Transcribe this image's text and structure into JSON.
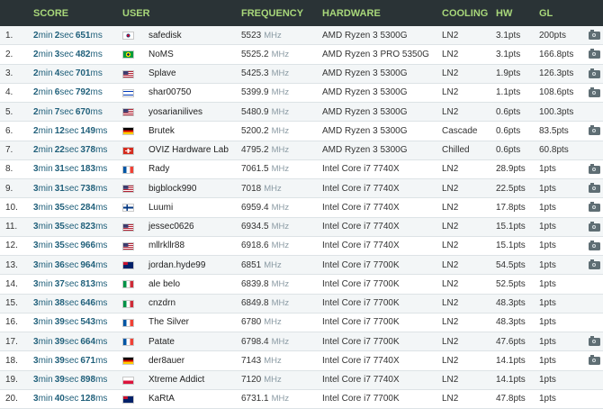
{
  "header": {
    "score": "SCORE",
    "user": "USER",
    "frequency": "FREQUENCY",
    "hardware": "HARDWARE",
    "cooling": "COOLING",
    "hw": "HW",
    "gl": "GL"
  },
  "rows": [
    {
      "rank": "1.",
      "m": "2",
      "s": "2",
      "ms": "651",
      "flag": "kr",
      "user": "safedisk",
      "freq": "5523",
      "hw": "AMD Ryzen 3 5300G",
      "cooling": "LN2",
      "pts": "3.1pts",
      "gl": "200pts",
      "cam": true
    },
    {
      "rank": "2.",
      "m": "2",
      "s": "3",
      "ms": "482",
      "flag": "br",
      "user": "NoMS",
      "freq": "5525.2",
      "hw": "AMD Ryzen 3 PRO 5350G",
      "cooling": "LN2",
      "pts": "3.1pts",
      "gl": "166.8pts",
      "cam": true
    },
    {
      "rank": "3.",
      "m": "2",
      "s": "4",
      "ms": "701",
      "flag": "us",
      "user": "Splave",
      "freq": "5425.3",
      "hw": "AMD Ryzen 3 5300G",
      "cooling": "LN2",
      "pts": "1.9pts",
      "gl": "126.3pts",
      "cam": true
    },
    {
      "rank": "4.",
      "m": "2",
      "s": "6",
      "ms": "792",
      "flag": "il",
      "user": "shar00750",
      "freq": "5399.9",
      "hw": "AMD Ryzen 3 5300G",
      "cooling": "LN2",
      "pts": "1.1pts",
      "gl": "108.6pts",
      "cam": true
    },
    {
      "rank": "5.",
      "m": "2",
      "s": "7",
      "ms": "670",
      "flag": "us",
      "user": "yosarianilives",
      "freq": "5480.9",
      "hw": "AMD Ryzen 3 5300G",
      "cooling": "LN2",
      "pts": "0.6pts",
      "gl": "100.3pts",
      "cam": false
    },
    {
      "rank": "6.",
      "m": "2",
      "s": "12",
      "ms": "149",
      "flag": "de",
      "user": "Brutek",
      "freq": "5200.2",
      "hw": "AMD Ryzen 3 5300G",
      "cooling": "Cascade",
      "pts": "0.6pts",
      "gl": "83.5pts",
      "cam": true
    },
    {
      "rank": "7.",
      "m": "2",
      "s": "22",
      "ms": "378",
      "flag": "ch",
      "user": "OVIZ Hardware Lab",
      "freq": "4795.2",
      "hw": "AMD Ryzen 3 5300G",
      "cooling": "Chilled",
      "pts": "0.6pts",
      "gl": "60.8pts",
      "cam": false
    },
    {
      "rank": "8.",
      "m": "3",
      "s": "31",
      "ms": "183",
      "flag": "fr",
      "user": "Rady",
      "freq": "7061.5",
      "hw": "Intel Core i7 7740X",
      "cooling": "LN2",
      "pts": "28.9pts",
      "gl": "1pts",
      "cam": true
    },
    {
      "rank": "9.",
      "m": "3",
      "s": "31",
      "ms": "738",
      "flag": "us",
      "user": "bigblock990",
      "freq": "7018",
      "hw": "Intel Core i7 7740X",
      "cooling": "LN2",
      "pts": "22.5pts",
      "gl": "1pts",
      "cam": true
    },
    {
      "rank": "10.",
      "m": "3",
      "s": "35",
      "ms": "284",
      "flag": "fi",
      "user": "Luumi",
      "freq": "6959.4",
      "hw": "Intel Core i7 7740X",
      "cooling": "LN2",
      "pts": "17.8pts",
      "gl": "1pts",
      "cam": true
    },
    {
      "rank": "11.",
      "m": "3",
      "s": "35",
      "ms": "823",
      "flag": "us",
      "user": "jessec0626",
      "freq": "6934.5",
      "hw": "Intel Core i7 7740X",
      "cooling": "LN2",
      "pts": "15.1pts",
      "gl": "1pts",
      "cam": true
    },
    {
      "rank": "12.",
      "m": "3",
      "s": "35",
      "ms": "966",
      "flag": "us",
      "user": "mllrkllr88",
      "freq": "6918.6",
      "hw": "Intel Core i7 7740X",
      "cooling": "LN2",
      "pts": "15.1pts",
      "gl": "1pts",
      "cam": true
    },
    {
      "rank": "13.",
      "m": "3",
      "s": "36",
      "ms": "964",
      "flag": "au",
      "user": "jordan.hyde99",
      "freq": "6851",
      "hw": "Intel Core i7 7700K",
      "cooling": "LN2",
      "pts": "54.5pts",
      "gl": "1pts",
      "cam": true
    },
    {
      "rank": "14.",
      "m": "3",
      "s": "37",
      "ms": "813",
      "flag": "it",
      "user": "ale belo",
      "freq": "6839.8",
      "hw": "Intel Core i7 7700K",
      "cooling": "LN2",
      "pts": "52.5pts",
      "gl": "1pts",
      "cam": false
    },
    {
      "rank": "15.",
      "m": "3",
      "s": "38",
      "ms": "646",
      "flag": "it",
      "user": "cnzdrn",
      "freq": "6849.8",
      "hw": "Intel Core i7 7700K",
      "cooling": "LN2",
      "pts": "48.3pts",
      "gl": "1pts",
      "cam": false
    },
    {
      "rank": "16.",
      "m": "3",
      "s": "39",
      "ms": "543",
      "flag": "fr",
      "user": "The Silver",
      "freq": "6780",
      "hw": "Intel Core i7 7700K",
      "cooling": "LN2",
      "pts": "48.3pts",
      "gl": "1pts",
      "cam": false
    },
    {
      "rank": "17.",
      "m": "3",
      "s": "39",
      "ms": "664",
      "flag": "fr",
      "user": "Patate",
      "freq": "6798.4",
      "hw": "Intel Core i7 7700K",
      "cooling": "LN2",
      "pts": "47.6pts",
      "gl": "1pts",
      "cam": true
    },
    {
      "rank": "18.",
      "m": "3",
      "s": "39",
      "ms": "671",
      "flag": "de",
      "user": "der8auer",
      "freq": "7143",
      "hw": "Intel Core i7 7740X",
      "cooling": "LN2",
      "pts": "14.1pts",
      "gl": "1pts",
      "cam": true
    },
    {
      "rank": "19.",
      "m": "3",
      "s": "39",
      "ms": "898",
      "flag": "pl",
      "user": "Xtreme Addict",
      "freq": "7120",
      "hw": "Intel Core i7 7740X",
      "cooling": "LN2",
      "pts": "14.1pts",
      "gl": "1pts",
      "cam": false
    },
    {
      "rank": "20.",
      "m": "3",
      "s": "40",
      "ms": "128",
      "flag": "au",
      "user": "KaRtA",
      "freq": "6731.1",
      "hw": "Intel Core i7 7700K",
      "cooling": "LN2",
      "pts": "47.8pts",
      "gl": "1pts",
      "cam": false
    }
  ],
  "units": {
    "min": "min",
    "sec": "sec",
    "ms": "ms",
    "mhz": "MHz"
  },
  "flag_colors": {
    "kr": "#ffffff",
    "br": "#2e9b3a",
    "us": "#b22234",
    "il": "#ffffff",
    "de": "#000000",
    "ch": "#d52b1e",
    "fr": "#0055a4",
    "fi": "#ffffff",
    "au": "#012169",
    "it": "#009246",
    "pl": "#ffffff"
  }
}
